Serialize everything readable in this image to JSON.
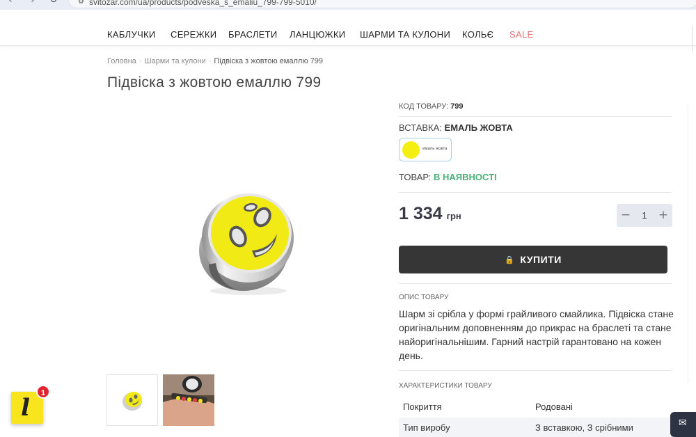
{
  "browser": {
    "back_icon": "‹",
    "forward_icon": "›",
    "reload_icon": "↻",
    "url": "svitozar.com/ua/products/podveska_s_emaliu_799-799-5010/"
  },
  "nav": {
    "items": [
      "КАБЛУЧКИ",
      "СЕРЕЖКИ",
      "БРАСЛЕТИ",
      "ЛАНЦЮЖКИ",
      "ШАРМИ ТА КУЛОНИ",
      "КОЛЬЄ"
    ],
    "sale": "SALE",
    "sale_color": "#e57373"
  },
  "breadcrumb": {
    "home": "Головна",
    "category": "Шарми та кулони",
    "current": "Підвіска з жовтою емаллю 799",
    "separator": "·"
  },
  "product": {
    "title": "Підвіска з жовтою емаллю 799",
    "code_label": "КОД ТОВАРУ:",
    "code_value": "799",
    "insert_label": "ВСТАВКА:",
    "insert_value": "ЕМАЛЬ ЖОВТА",
    "swatch_label": "емаль жовта",
    "swatch_color": "#f5ee13",
    "stock_label": "ТОВАР:",
    "stock_value": "В НАЯВНОСТІ",
    "stock_color": "#4caf78",
    "price": "1 334",
    "currency": "грн",
    "quantity": "1",
    "qty_minus": "−",
    "qty_plus": "+",
    "buy_label": "КУПИТИ",
    "buy_icon": "bag-icon",
    "desc_label": "ОПИС ТОВАРУ",
    "description": "Шарм зі срібла у формі грайливого смайлика. Підвіска стане оригінальним доповненням до прикрас на браслеті та стане найоригінальнішим. Гарний настрій гарантовано на кожен день.",
    "specs_label": "ХАРАКТЕРИСТИКИ ТОВАРУ",
    "specs": [
      {
        "key": "Покриття",
        "value": "Родовані"
      },
      {
        "key": "Тип виробу",
        "value": "З вставкою, З срібними"
      }
    ]
  },
  "widgets": {
    "logo_letter": "l",
    "logo_badge": "1",
    "chat_icon": "chat-icon"
  }
}
